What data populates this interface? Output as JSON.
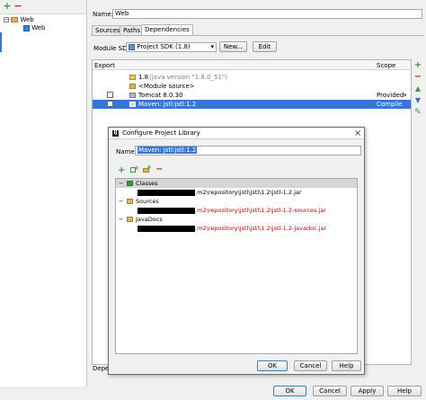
{
  "left_tree": {
    "toolbar": {
      "add_label": "+",
      "remove_label": "−"
    },
    "items": [
      {
        "label": "Web",
        "expanded": "−"
      },
      {
        "label": "Web"
      }
    ]
  },
  "module": {
    "name_label": "Name:",
    "name_value": "Web",
    "tabs": [
      "Sources",
      "Paths",
      "Dependencies"
    ],
    "sdk_label": "Module SDK:",
    "sdk_value": "Project SDK (1.8)",
    "new_button": "New...",
    "edit_button": "Edit"
  },
  "dependencies": {
    "col_export": "Export",
    "col_scope": "Scope",
    "rows": [
      {
        "label": "1.8",
        "detail": "(java version \"1.8.0_51\")",
        "scope": ""
      },
      {
        "label": "<Module source>",
        "scope": ""
      },
      {
        "label": "Tomcat 8.0.30",
        "scope": "Provided"
      },
      {
        "label": "Maven: jstl:jstl:1.2",
        "scope": "Compile"
      }
    ],
    "bottom_label": "Depen"
  },
  "dialog": {
    "title": "Configure Project Library",
    "close_glyph": "×",
    "name_label": "Name:",
    "name_value": "Maven: jstl:jstl:1.2",
    "toolbar": {
      "add": "+",
      "remove": "−"
    },
    "groups": [
      {
        "label": "Classes",
        "path": ".m2\\repository\\jstl\\jstl\\1.2\\jstl-1.2.jar"
      },
      {
        "label": "Sources",
        "path": ".m2\\repository\\jstl\\jstl\\1.2\\jstl-1.2-sources.jar"
      },
      {
        "label": "JavaDocs",
        "path": ".m2\\repository\\jstl\\jstl\\1.2\\jstl-1.2-javadoc.jar"
      }
    ],
    "ok": "OK",
    "cancel": "Cancel",
    "help": "Help"
  },
  "footer": {
    "ok": "OK",
    "cancel": "Cancel",
    "apply": "Apply",
    "help": "Help"
  },
  "colors": {
    "selection": "#3875d7",
    "add_green": "#3a9a3a",
    "remove_red": "#cc2222",
    "path_red": "#c00000"
  },
  "icons": [
    "add-icon",
    "remove-icon",
    "folder-icon",
    "web-module-icon",
    "jdk-icon",
    "library-icon",
    "edit-icon",
    "arrow-up-icon",
    "arrow-down-icon"
  ]
}
